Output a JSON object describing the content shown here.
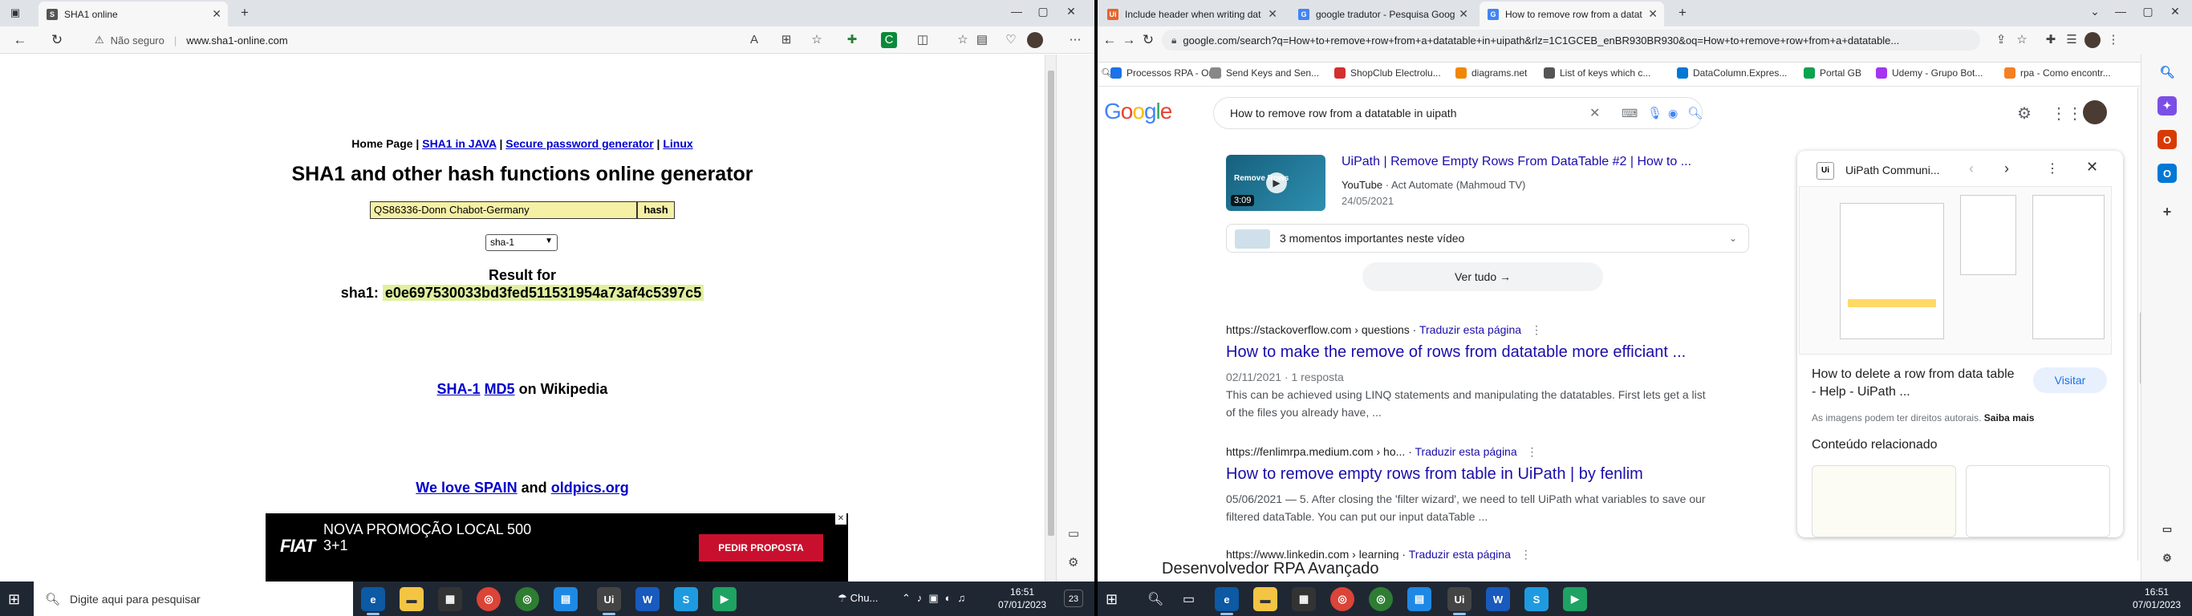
{
  "left_browser": {
    "tab_title": "SHA1 online",
    "security_label": "Não seguro",
    "url": "www.sha1-online.com"
  },
  "sha1_page": {
    "nav": {
      "home": "Home Page",
      "sep": "|",
      "java": "SHA1 in JAVA",
      "password": "Secure password generator",
      "linux": "Linux"
    },
    "heading": "SHA1 and other hash functions online generator",
    "input_value": "QS86336-Donn Chabot-Germany",
    "hash_button": "hash",
    "algorithm": "sha-1",
    "result_label": "Result for",
    "result_prefix": "sha1:",
    "result_hash": "e0e697530033bd3fed511531954a73af4c5397c5",
    "wiki_sha": "SHA-1",
    "wiki_md5": "MD5",
    "wiki_suffix": "on Wikipedia",
    "love_a": "We love SPAIN",
    "love_and": "and",
    "love_b": "oldpics.org",
    "ad": {
      "brand": "FIAT",
      "line1": "NOVA PROMOÇÃO LOCAL 500",
      "line2": "3+1",
      "cta": "PEDIR PROPOSTA",
      "close": "✕"
    }
  },
  "right_browser": {
    "tabs": [
      {
        "title": "Include header when writing dat",
        "color": "#e8632b",
        "glyph": "Ui"
      },
      {
        "title": "google tradutor - Pesquisa Goog",
        "color": "#4285f4",
        "glyph": "G"
      },
      {
        "title": "How to remove row from a datat",
        "color": "#4285f4",
        "glyph": "G"
      }
    ],
    "url": "google.com/search?q=How+to+remove+row+from+a+datatable+in+uipath&rlz=1C1GCEB_enBR930BR930&oq=How+to+remove+row+from+a+datatable...",
    "bookmarks": [
      {
        "label": "Processos RPA - On...",
        "color": "#1a73e8"
      },
      {
        "label": "Send Keys and Sen...",
        "color": "#888888"
      },
      {
        "label": "ShopClub Electrolu...",
        "color": "#d32f2f"
      },
      {
        "label": "diagrams.net",
        "color": "#f08705"
      },
      {
        "label": "List of keys which c...",
        "color": "#555555"
      },
      {
        "label": "DataColumn.Expres...",
        "color": "#0078d4"
      },
      {
        "label": "Portal GB",
        "color": "#0aa34f"
      },
      {
        "label": "Udemy - Grupo Bot...",
        "color": "#a435f0"
      },
      {
        "label": "rpa - Como encontr...",
        "color": "#f48024"
      }
    ]
  },
  "google": {
    "logo": "Google",
    "query": "How to remove row from a datatable in uipath",
    "video": {
      "title": "UiPath | Remove Empty Rows From DataTable #2 | How to ...",
      "source": "YouTube",
      "author": "Act Automate (Mahmoud TV)",
      "date": "24/05/2021",
      "duration": "3:09",
      "thumb_text": "Remove Rows"
    },
    "moments": "3 momentos importantes neste vídeo",
    "see_all": "Ver tudo",
    "results": [
      {
        "url": "https://stackoverflow.com › questions",
        "translate": "Traduzir esta página",
        "title": "How to make the remove of rows from datatable more efficiant ...",
        "meta": "02/11/2021 · 1 resposta",
        "snippet": "This can be achieved using LINQ statements and manipulating the datatables. First lets get a list of the files you already have, ..."
      },
      {
        "url": "https://fenlimrpa.medium.com › ho...",
        "translate": "Traduzir esta página",
        "title": "How to remove empty rows from table in UiPath | by fenlim",
        "meta": "05/06/2021 — 5. After closing the 'filter wizard', we need to tell UiPath what variables to save our filtered dataTable. You can put our input dataTable ..."
      },
      {
        "url": "https://www.linkedin.com › learning",
        "translate": "Traduzir esta página",
        "title": "Desenvolvedor RPA Avançado"
      }
    ],
    "panel": {
      "source": "UiPath Communi...",
      "title": "How to delete a row from data table - Help - UiPath ...",
      "visit": "Visitar",
      "rights": "As imagens podem ter direitos autorais.",
      "more": "Saiba mais",
      "related": "Conteúdo relacionado"
    }
  },
  "taskbar": {
    "search_placeholder": "Digite aqui para pesquisar",
    "weather": "Chu...",
    "time": "16:51",
    "date": "07/01/2023",
    "badge": "23"
  }
}
